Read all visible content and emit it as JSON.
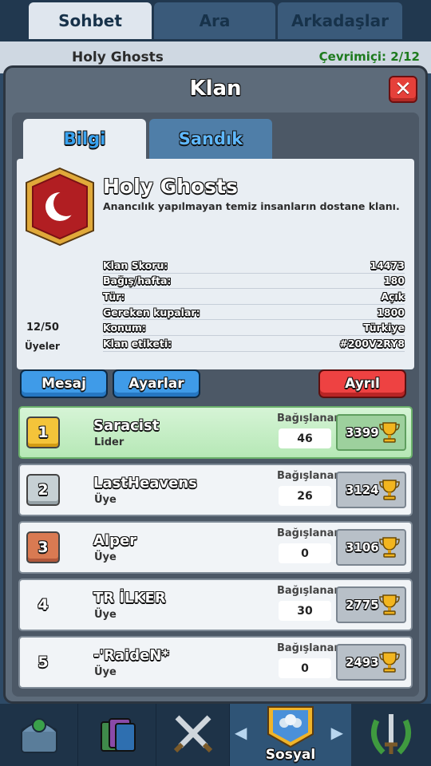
{
  "top_tabs": [
    "Sohbet",
    "Ara",
    "Arkadaşlar"
  ],
  "background": {
    "clan_name": "Holy Ghosts",
    "online_text": "Çevrimiçi: 2/12"
  },
  "dialog": {
    "title": "Klan",
    "tabs": {
      "info": "Bilgi",
      "chest": "Sandık"
    },
    "clan": {
      "name": "Holy Ghosts",
      "description": "Anancılık yapılmayan temiz insanların dostane klanı.",
      "stats": [
        {
          "label": "Klan Skoru:",
          "value": "14473"
        },
        {
          "label": "Bağış/hafta:",
          "value": "180"
        },
        {
          "label": "Tür:",
          "value": "Açık"
        },
        {
          "label": "Gereken kupalar:",
          "value": "1800"
        },
        {
          "label": "Konum:",
          "value": "Türkiye"
        },
        {
          "label": "Klan etiketi:",
          "value": "#200V2RY8"
        }
      ],
      "members_count": "12/50",
      "members_label": "Üyeler"
    },
    "buttons": {
      "message": "Mesaj",
      "settings": "Ayarlar",
      "leave": "Ayrıl"
    },
    "donated_label": "Bağışlanan",
    "members": [
      {
        "rank": "1",
        "name": "Saracist",
        "role": "Lider",
        "donated": "46",
        "trophies": "3399"
      },
      {
        "rank": "2",
        "name": "LastHeavens",
        "role": "Üye",
        "donated": "26",
        "trophies": "3124"
      },
      {
        "rank": "3",
        "name": "Alper",
        "role": "Üye",
        "donated": "0",
        "trophies": "3106"
      },
      {
        "rank": "4",
        "name": "TR İLKER",
        "role": "Üye",
        "donated": "30",
        "trophies": "2775"
      },
      {
        "rank": "5",
        "name": "-'RaideN*",
        "role": "Üye",
        "donated": "0",
        "trophies": "2493"
      }
    ]
  },
  "bottom_nav": {
    "social_label": "Sosyal"
  },
  "colors": {
    "accent_blue": "#3f9be8",
    "danger_red": "#ee4242",
    "leader_green": "#b6e8b6",
    "gold": "#f4c43a"
  }
}
